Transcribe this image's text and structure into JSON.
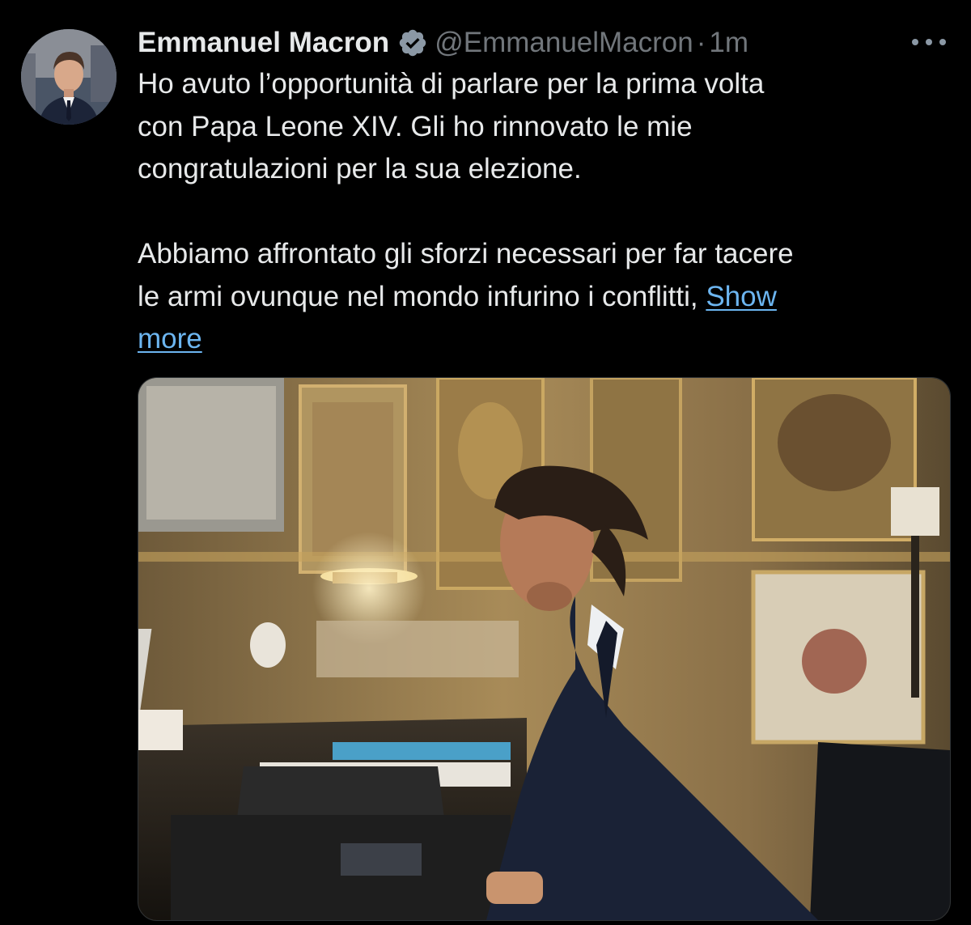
{
  "tweet": {
    "author": {
      "display_name": "Emmanuel Macron",
      "verified": true,
      "handle": "@EmmanuelMacron",
      "separator": "·",
      "time": "1m"
    },
    "text": {
      "line1": "Ho avuto l’opportunità di parlare per la prima volta",
      "line2": "con Papa Leone XIV. Gli ho rinnovato le mie",
      "line3": "congratulazioni per la sua elezione.",
      "line4": "Abbiamo affrontato gli sforzi necessari per far tacere",
      "line5": "le armi ovunque nel mondo infurino i conflitti, ",
      "show_more_part1": "Show",
      "show_more_part2": "more"
    },
    "icons": {
      "verified": "verified-badge-icon",
      "more": "more-options-icon"
    },
    "colors": {
      "background": "#000000",
      "text": "#e7e9ea",
      "secondary": "#71767b",
      "link": "#6cb5f0"
    }
  }
}
